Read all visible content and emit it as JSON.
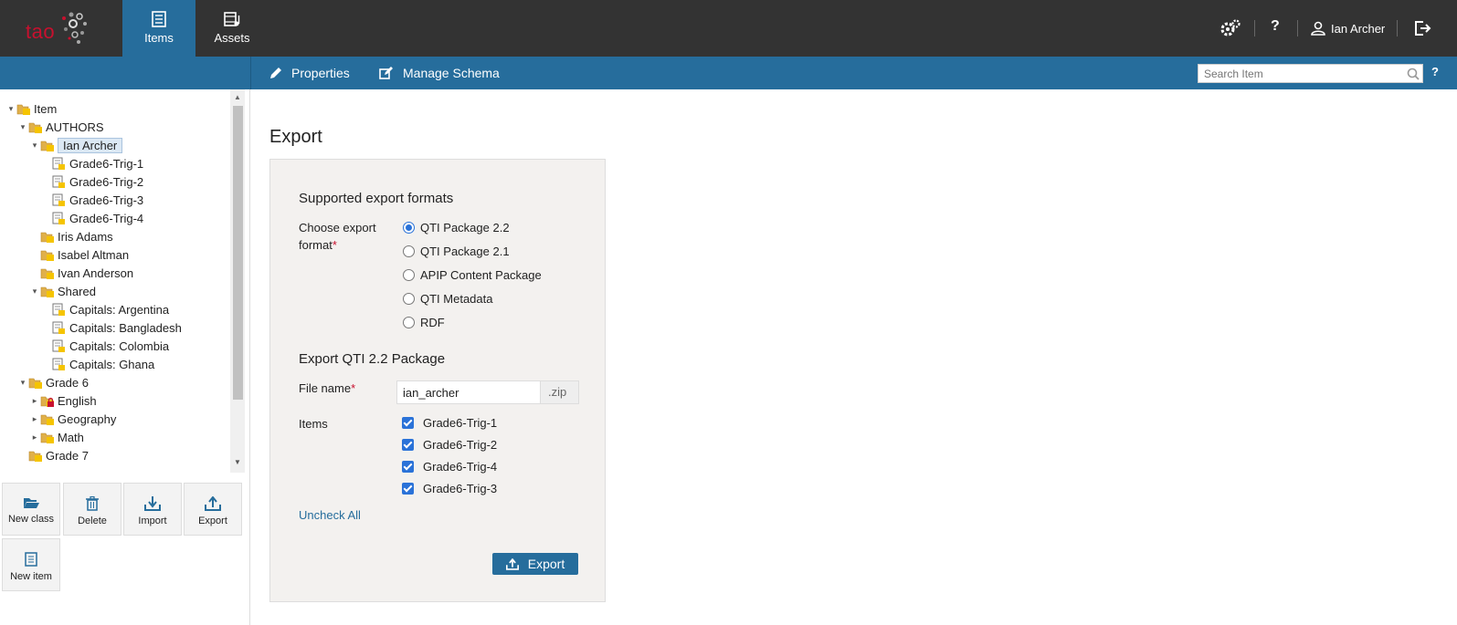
{
  "header": {
    "logo_text": "tao",
    "tabs": [
      {
        "label": "Items",
        "icon": "items-icon",
        "active": true
      },
      {
        "label": "Assets",
        "icon": "assets-icon",
        "active": false
      }
    ],
    "user_name": "Ian Archer",
    "accent_color": "#266d9c"
  },
  "actionbar": {
    "properties_label": "Properties",
    "manage_schema_label": "Manage Schema",
    "search_placeholder": "Search Item",
    "help_label": "?"
  },
  "tree": [
    {
      "label": "Item",
      "type": "class",
      "depth": 0,
      "expanded": true
    },
    {
      "label": "AUTHORS",
      "type": "class",
      "depth": 1,
      "expanded": true
    },
    {
      "label": "Ian Archer",
      "type": "class",
      "depth": 2,
      "expanded": true,
      "selected": true
    },
    {
      "label": "Grade6-Trig-1",
      "type": "item",
      "depth": 3
    },
    {
      "label": "Grade6-Trig-2",
      "type": "item",
      "depth": 3
    },
    {
      "label": "Grade6-Trig-3",
      "type": "item",
      "depth": 3
    },
    {
      "label": "Grade6-Trig-4",
      "type": "item",
      "depth": 3
    },
    {
      "label": "Iris Adams",
      "type": "class",
      "depth": 2
    },
    {
      "label": "Isabel Altman",
      "type": "class",
      "depth": 2
    },
    {
      "label": "Ivan Anderson",
      "type": "class",
      "depth": 2
    },
    {
      "label": "Shared",
      "type": "class",
      "depth": 2,
      "expanded": true
    },
    {
      "label": "Capitals: Argentina",
      "type": "item",
      "depth": 3
    },
    {
      "label": "Capitals: Bangladesh",
      "type": "item",
      "depth": 3
    },
    {
      "label": "Capitals: Colombia",
      "type": "item",
      "depth": 3
    },
    {
      "label": "Capitals: Ghana",
      "type": "item",
      "depth": 3
    },
    {
      "label": "Grade 6",
      "type": "class",
      "depth": 1,
      "expanded": true
    },
    {
      "label": "English",
      "type": "locked-class",
      "depth": 2,
      "collapsed": true
    },
    {
      "label": "Geography",
      "type": "class",
      "depth": 2,
      "collapsed": true
    },
    {
      "label": "Math",
      "type": "class",
      "depth": 2,
      "collapsed": true
    },
    {
      "label": "Grade 7",
      "type": "class",
      "depth": 1
    }
  ],
  "toolbar": {
    "new_class": "New class",
    "delete": "Delete",
    "import": "Import",
    "export": "Export",
    "new_item": "New item"
  },
  "main": {
    "title": "Export",
    "formats_heading": "Supported export formats",
    "format_label": "Choose export format",
    "formats": [
      {
        "label": "QTI Package 2.2",
        "selected": true
      },
      {
        "label": "QTI Package 2.1",
        "selected": false
      },
      {
        "label": "APIP Content Package",
        "selected": false
      },
      {
        "label": "QTI Metadata",
        "selected": false
      },
      {
        "label": "RDF",
        "selected": false
      }
    ],
    "package_heading": "Export QTI 2.2 Package",
    "file_name_label": "File name",
    "file_name_value": "ian_archer",
    "file_ext": ".zip",
    "items_label": "Items",
    "items": [
      {
        "label": "Grade6-Trig-1",
        "checked": true
      },
      {
        "label": "Grade6-Trig-2",
        "checked": true
      },
      {
        "label": "Grade6-Trig-4",
        "checked": true
      },
      {
        "label": "Grade6-Trig-3",
        "checked": true
      }
    ],
    "uncheck_all": "Uncheck All",
    "export_button": "Export",
    "required_mark": "*"
  }
}
